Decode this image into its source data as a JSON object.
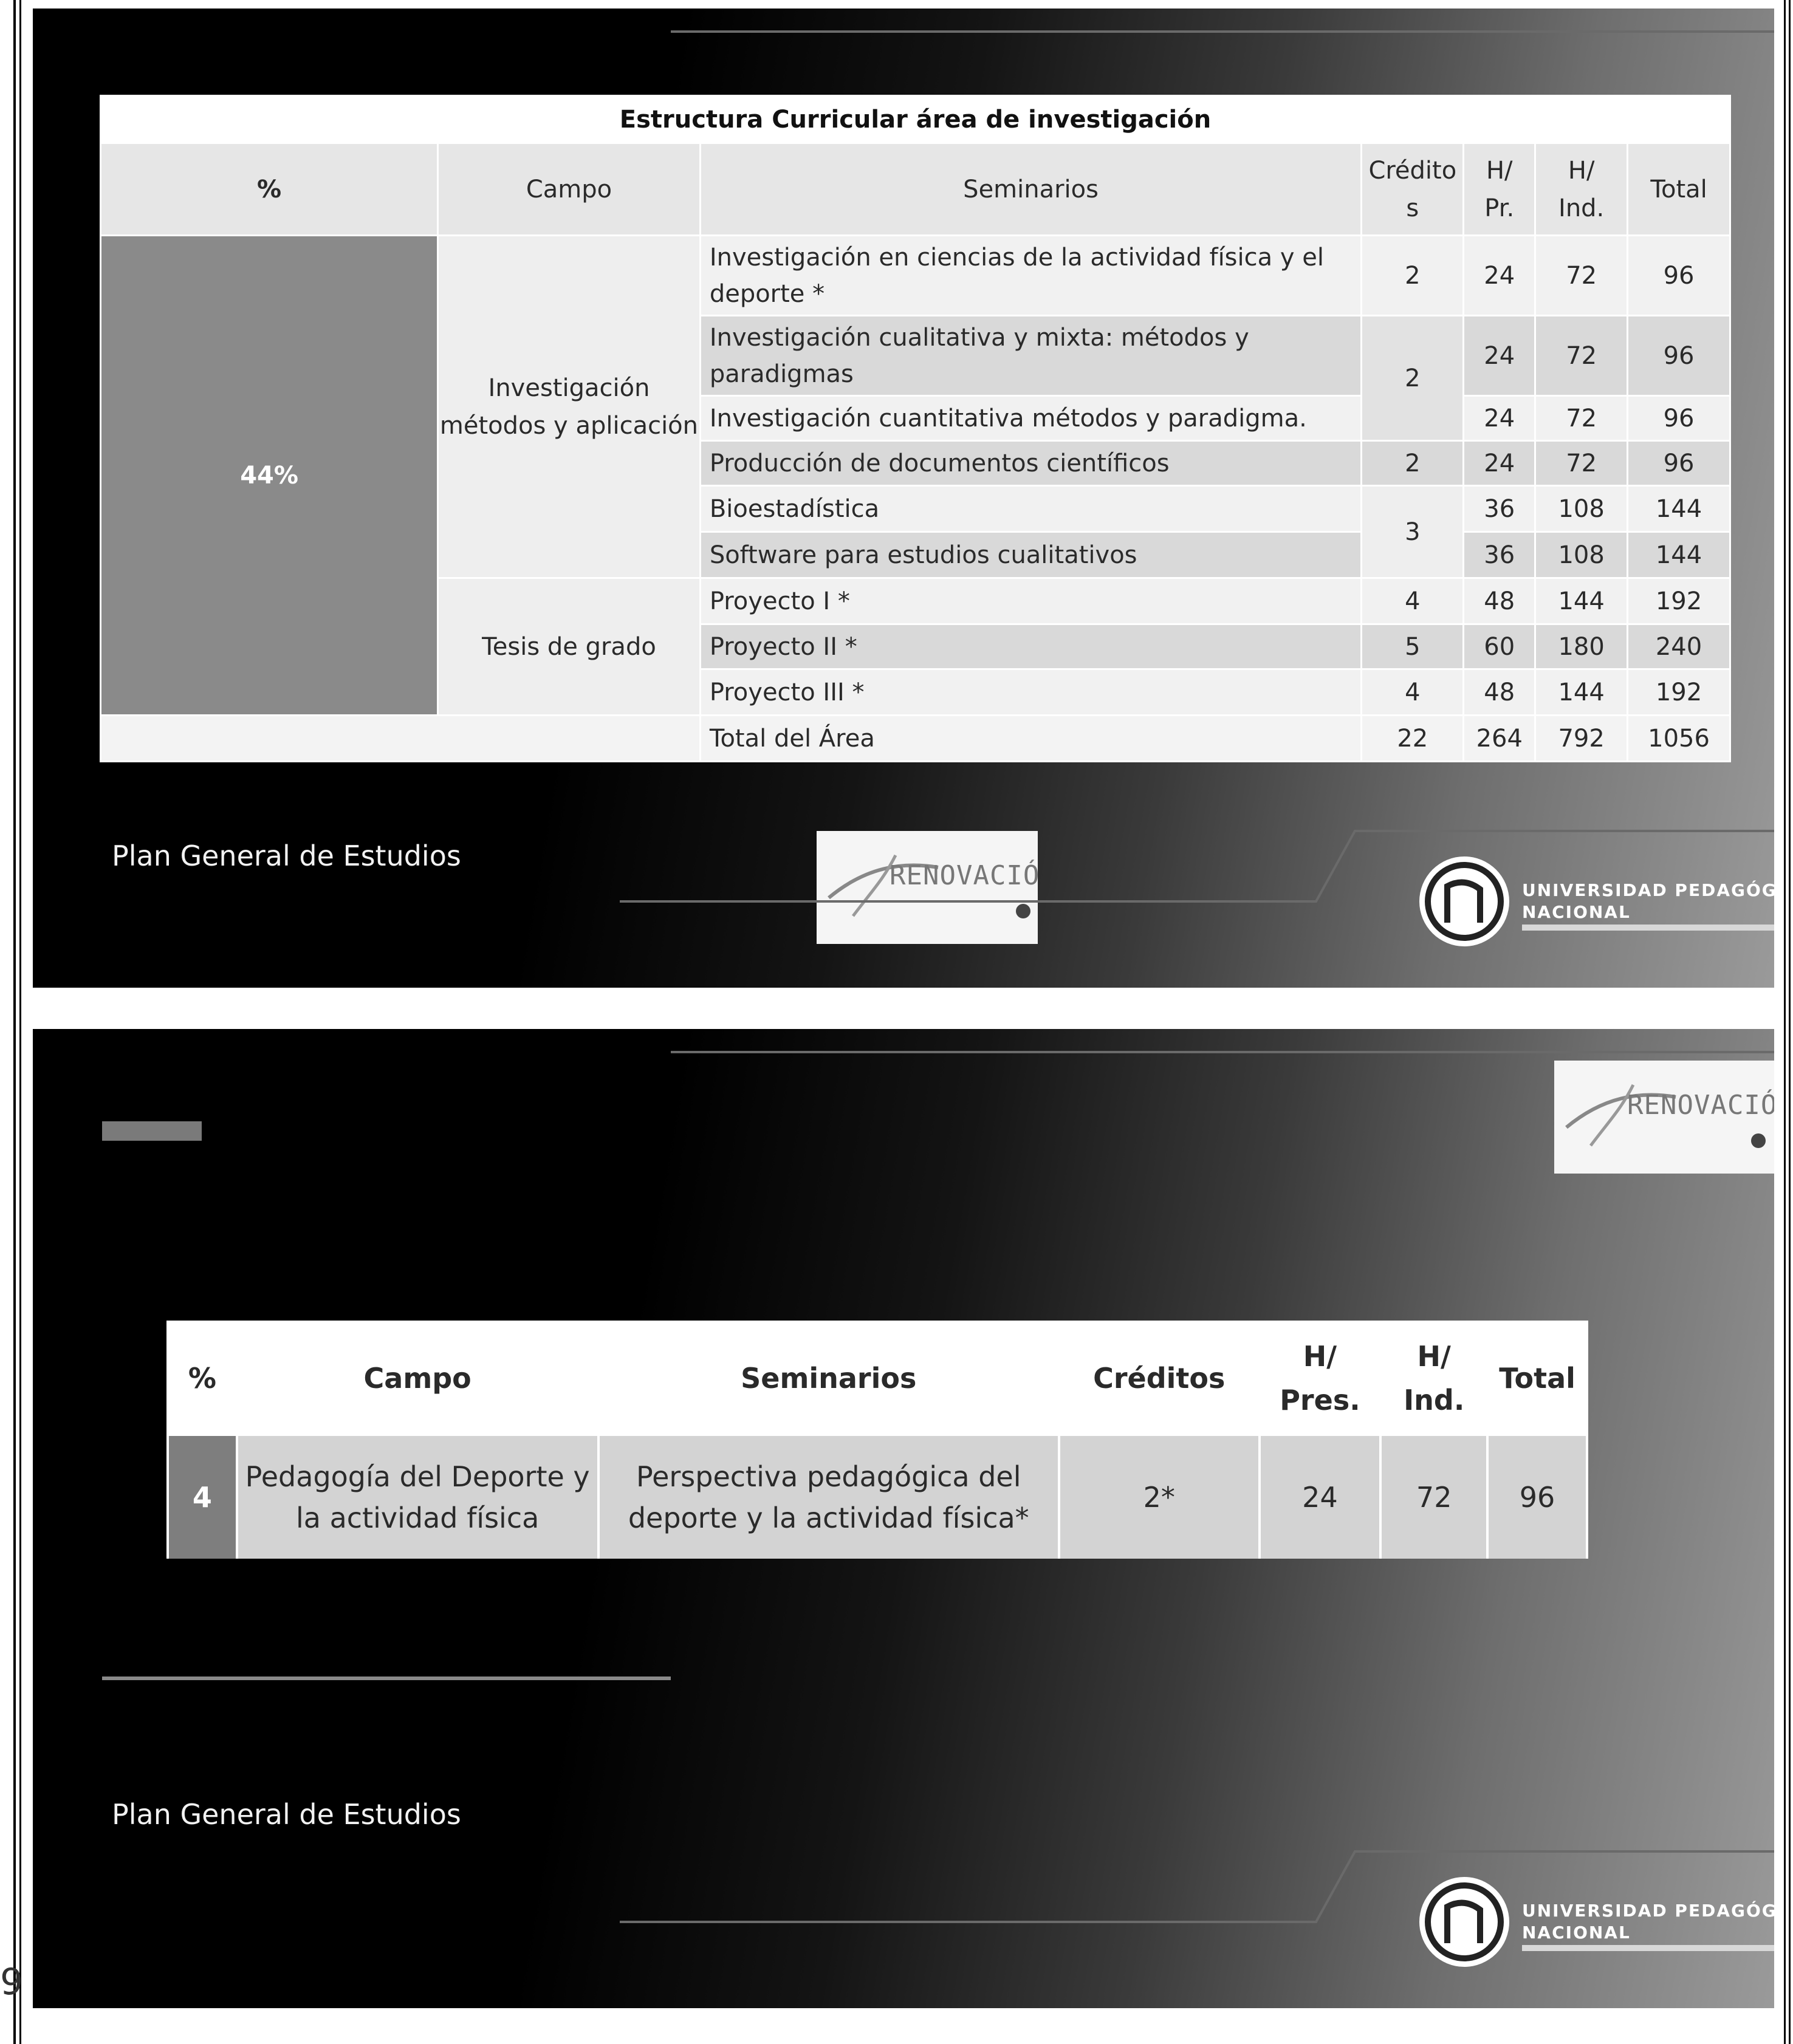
{
  "slide1": {
    "table": {
      "title": "Estructura Curricular área de investigación",
      "headers": {
        "pct": "%",
        "campo": "Campo",
        "seminarios": "Seminarios",
        "creditos": "Crédito\ns",
        "hpr": "H/\nPr.",
        "hind": "H/\nInd.",
        "total": "Total"
      },
      "percentage": "44%",
      "campos": [
        "Investigación\nmétodos y aplicación",
        "Tesis de grado"
      ],
      "rows": [
        {
          "seminario": "Investigación en ciencias de la actividad física y el deporte *",
          "creditos": "2",
          "hpr": "24",
          "hind": "72",
          "total": "96"
        },
        {
          "seminario": "Investigación cualitativa y mixta: métodos y paradigmas",
          "creditos": "2",
          "hpr": "24",
          "hind": "72",
          "total": "96"
        },
        {
          "seminario": "Investigación cuantitativa métodos y paradigma.",
          "creditos": "",
          "hpr": "24",
          "hind": "72",
          "total": "96"
        },
        {
          "seminario": "Producción de documentos científicos",
          "creditos": "2",
          "hpr": "24",
          "hind": "72",
          "total": "96"
        },
        {
          "seminario": "Bioestadística",
          "creditos": "3",
          "hpr": "36",
          "hind": "108",
          "total": "144"
        },
        {
          "seminario": "Software para estudios cualitativos",
          "creditos": "",
          "hpr": "36",
          "hind": "108",
          "total": "144"
        },
        {
          "seminario": "Proyecto I *",
          "creditos": "4",
          "hpr": "48",
          "hind": "144",
          "total": "192"
        },
        {
          "seminario": "Proyecto II *",
          "creditos": "5",
          "hpr": "60",
          "hind": "180",
          "total": "240"
        },
        {
          "seminario": "Proyecto III *",
          "creditos": "4",
          "hpr": "48",
          "hind": "144",
          "total": "192"
        }
      ],
      "total_row": {
        "label": "Total del Área",
        "creditos": "22",
        "hpr": "264",
        "hind": "792",
        "total": "1056"
      }
    },
    "footer": "Plan General de Estudios",
    "logo_renovacion": "RENOVACIÓN",
    "logo_upn": "UNIVERSIDAD PEDAGÓGICA\nNACIONAL"
  },
  "slide2": {
    "table": {
      "headers": {
        "pct": "%",
        "campo": "Campo",
        "seminarios": "Seminarios",
        "creditos": "Créditos",
        "hpres": "H/\nPres.",
        "hind": "H/\nInd.",
        "total": "Total"
      },
      "row": {
        "pct": "4",
        "campo": "Pedagogía del Deporte y\nla actividad física",
        "seminario": "Perspectiva pedagógica del\ndeporte y la actividad física*",
        "creditos": "2*",
        "hpres": "24",
        "hind": "72",
        "total": "96"
      }
    },
    "footer": "Plan General de Estudios",
    "logo_renovacion": "RENOVACIÓN",
    "logo_upn": "UNIVERSIDAD PEDAGÓGICA\nNACIONAL"
  },
  "page_marks": {
    "left_glyph": "9"
  },
  "colors": {
    "slide_bg_dark": "#000000",
    "slide_bg_light": "#9a9a9a",
    "pct_cell": "#8a8a8a",
    "row_dark": "#d9d9d9",
    "row_light": "#f1f1f1"
  }
}
